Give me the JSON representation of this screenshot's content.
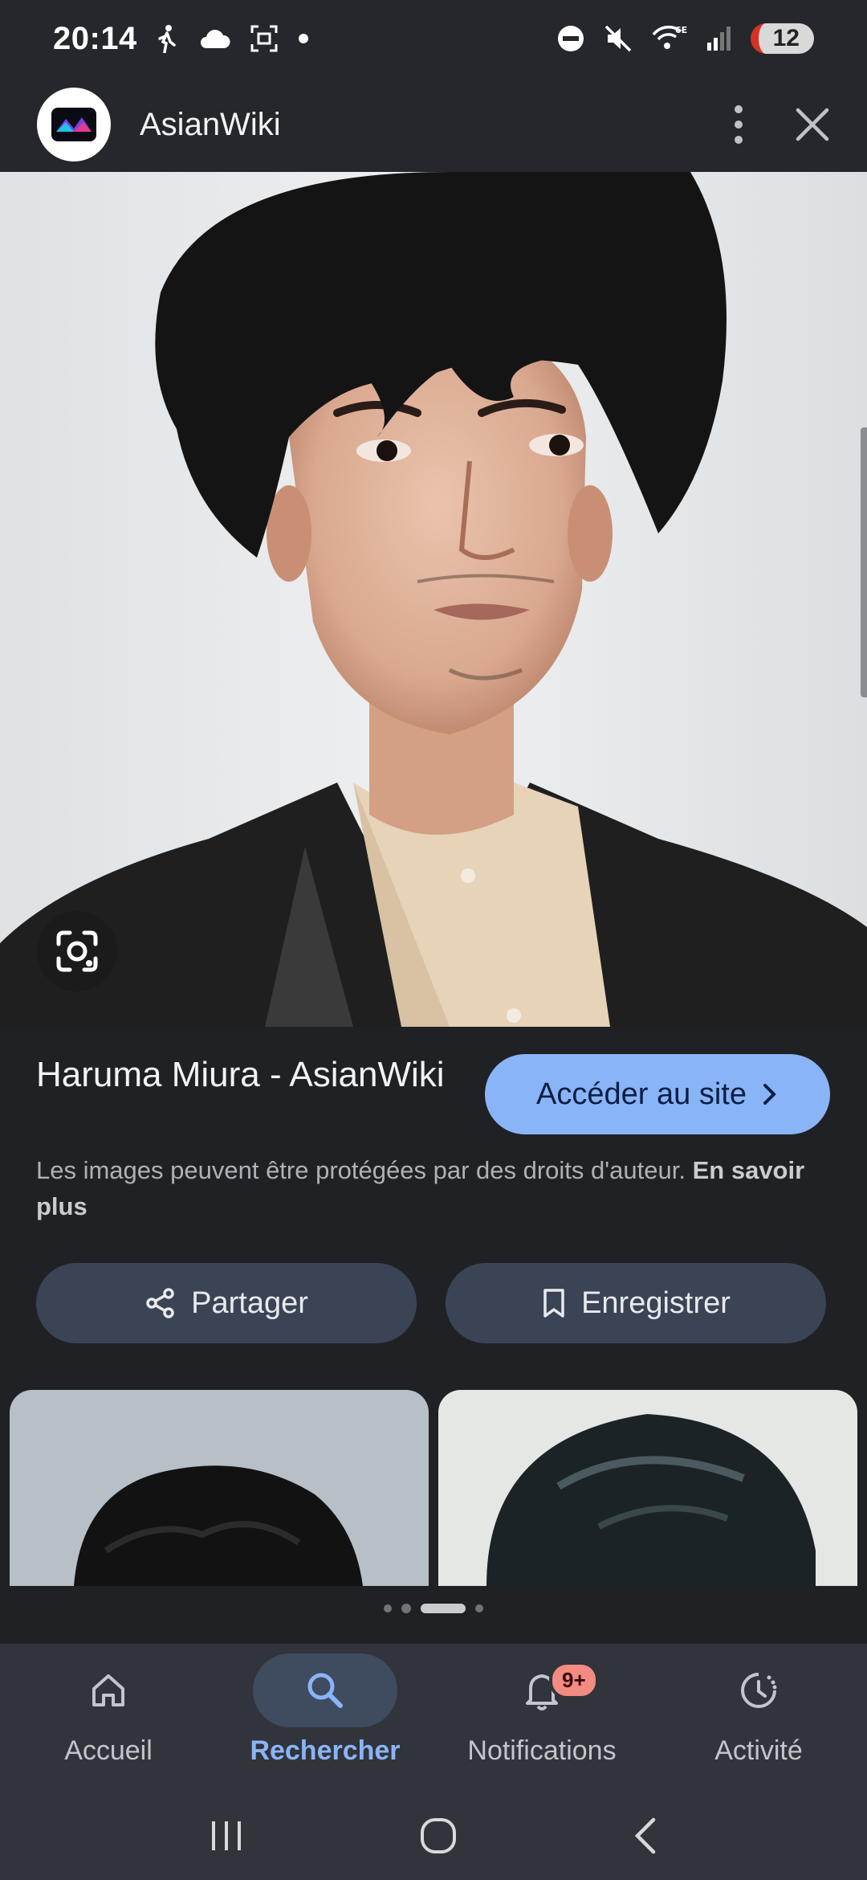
{
  "status_bar": {
    "time": "20:14",
    "battery": "12",
    "icons": [
      "walking-icon",
      "cloud-icon",
      "screenshot-icon",
      "dot-icon",
      "dnd-icon",
      "mute-icon",
      "wifi-6e-icon",
      "signal-icon"
    ]
  },
  "app_bar": {
    "site_name": "AsianWiki",
    "menu_icon": "more-vert-icon",
    "close_icon": "close-icon"
  },
  "result": {
    "title": "Haruma Miura - AsianWiki",
    "visit_label": "Accéder au site",
    "copyright_text": "Les images peuvent être protégées par des droits d'auteur.",
    "learn_more": "En savoir plus",
    "share_label": "Partager",
    "save_label": "Enregistrer"
  },
  "bottom_nav": {
    "items": [
      {
        "label": "Accueil",
        "icon": "home-icon",
        "active": false
      },
      {
        "label": "Rechercher",
        "icon": "search-icon",
        "active": true
      },
      {
        "label": "Notifications",
        "icon": "bell-icon",
        "active": false,
        "badge": "9+"
      },
      {
        "label": "Activité",
        "icon": "history-icon",
        "active": false
      }
    ]
  },
  "colors": {
    "background": "#202124",
    "accent": "#8ab4f8",
    "chip_bg": "#3b4455",
    "badge": "#f28b82"
  }
}
